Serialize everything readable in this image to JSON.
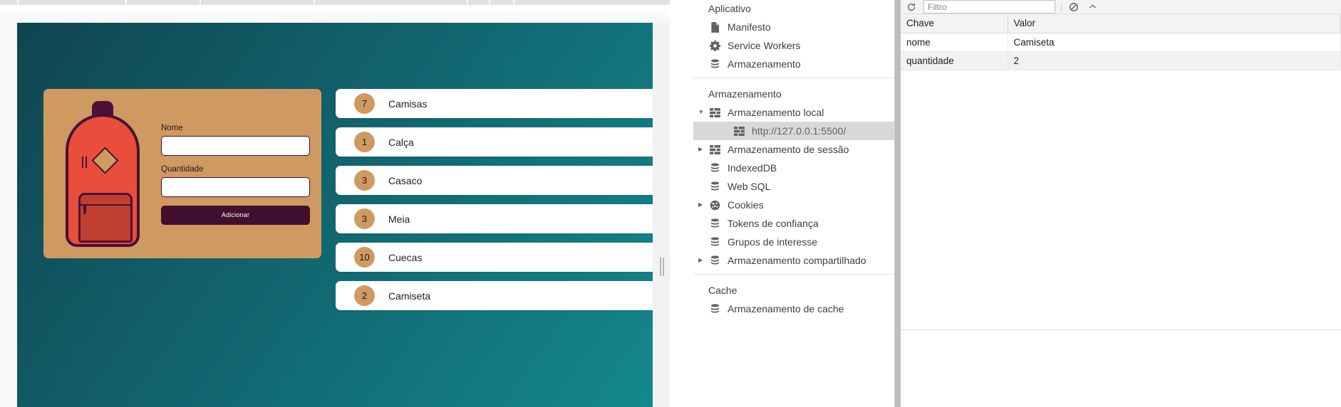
{
  "browser": {
    "tab_strip_separator_count": 12
  },
  "app": {
    "form": {
      "name_label": "Nome",
      "name_value": "",
      "name_placeholder": "",
      "quantity_label": "Quantidade",
      "quantity_value": "",
      "quantity_placeholder": "",
      "submit_label": "Adicionar"
    },
    "items": [
      {
        "quantity": "7",
        "name": "Camisas"
      },
      {
        "quantity": "1",
        "name": "Calça"
      },
      {
        "quantity": "3",
        "name": "Casaco"
      },
      {
        "quantity": "3",
        "name": "Meia"
      },
      {
        "quantity": "10",
        "name": "Cuecas"
      },
      {
        "quantity": "2",
        "name": "Camiseta"
      }
    ],
    "colors": {
      "background_dark": "#0f4550",
      "background_light": "#13888c",
      "card": "#cf9a61",
      "accent_dark": "#42102f",
      "bag_red": "#e94e3c"
    }
  },
  "devtools": {
    "sections": [
      {
        "title": "Aplicativo",
        "nodes": [
          {
            "label": "Manifesto",
            "icon": "manifest-icon",
            "twisty": "",
            "indent": 0,
            "selected": false
          },
          {
            "label": "Service Workers",
            "icon": "gear-icon",
            "twisty": "",
            "indent": 0,
            "selected": false
          },
          {
            "label": "Armazenamento",
            "icon": "database-icon",
            "twisty": "",
            "indent": 0,
            "selected": false
          }
        ]
      },
      {
        "title": "Armazenamento",
        "nodes": [
          {
            "label": "Armazenamento local",
            "icon": "table-icon",
            "twisty": "▼",
            "indent": 0,
            "selected": false
          },
          {
            "label": "http://127.0.0.1:5500/",
            "icon": "table-icon",
            "twisty": "",
            "indent": 1,
            "selected": true
          },
          {
            "label": "Armazenamento de sessão",
            "icon": "table-icon",
            "twisty": "▶",
            "indent": 0,
            "selected": false
          },
          {
            "label": "IndexedDB",
            "icon": "database-icon",
            "twisty": "",
            "indent": 0,
            "selected": false
          },
          {
            "label": "Web SQL",
            "icon": "database-icon",
            "twisty": "",
            "indent": 0,
            "selected": false
          },
          {
            "label": "Cookies",
            "icon": "cookie-icon",
            "twisty": "▶",
            "indent": 0,
            "selected": false
          },
          {
            "label": "Tokens de confiança",
            "icon": "database-icon",
            "twisty": "",
            "indent": 0,
            "selected": false
          },
          {
            "label": "Grupos de interesse",
            "icon": "database-icon",
            "twisty": "",
            "indent": 0,
            "selected": false
          },
          {
            "label": "Armazenamento compartilhado",
            "icon": "database-icon",
            "twisty": "▶",
            "indent": 0,
            "selected": false
          }
        ]
      },
      {
        "title": "Cache",
        "nodes": [
          {
            "label": "Armazenamento de cache",
            "icon": "database-icon",
            "twisty": "",
            "indent": 0,
            "selected": false
          }
        ]
      }
    ],
    "toolbar": {
      "refresh_label": "refresh-icon",
      "filter_placeholder": "Filtro",
      "filter_value": "",
      "clear_label": "clear-icon",
      "close_label": "close-icon"
    },
    "table": {
      "columns": [
        "Chave",
        "Valor"
      ],
      "rows": [
        {
          "key": "nome",
          "value": "Camiseta"
        },
        {
          "key": "quantidade",
          "value": "2"
        }
      ]
    }
  }
}
